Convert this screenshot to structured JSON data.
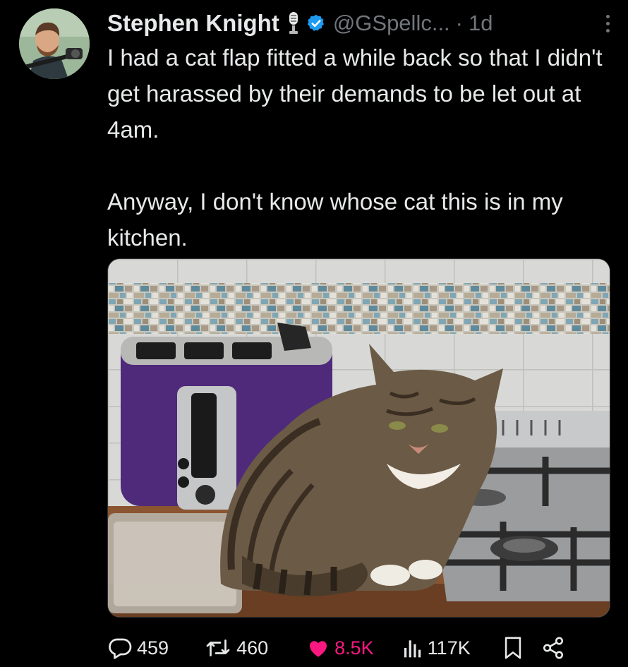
{
  "tweet": {
    "author_name": "Stephen Knight",
    "handle": "@GSpellc...",
    "separator": "·",
    "time": "1d",
    "paragraphs": [
      "I had a cat flap fitted a while back so that I didn't get harassed by  their demands to be let out at 4am.",
      "Anyway, I don't know whose cat this is in my kitchen."
    ]
  },
  "actions": {
    "replies": "459",
    "reposts": "460",
    "likes": "8.5K",
    "views": "117K"
  },
  "colors": {
    "background": "#000000",
    "text": "#e7e9ea",
    "muted": "#71767b",
    "like": "#f91880",
    "verified": "#1d9bf0"
  },
  "icons": [
    "microphone-icon",
    "verified-badge-icon",
    "more-icon",
    "reply-icon",
    "repost-icon",
    "heart-icon",
    "views-icon",
    "bookmark-icon",
    "share-icon"
  ]
}
